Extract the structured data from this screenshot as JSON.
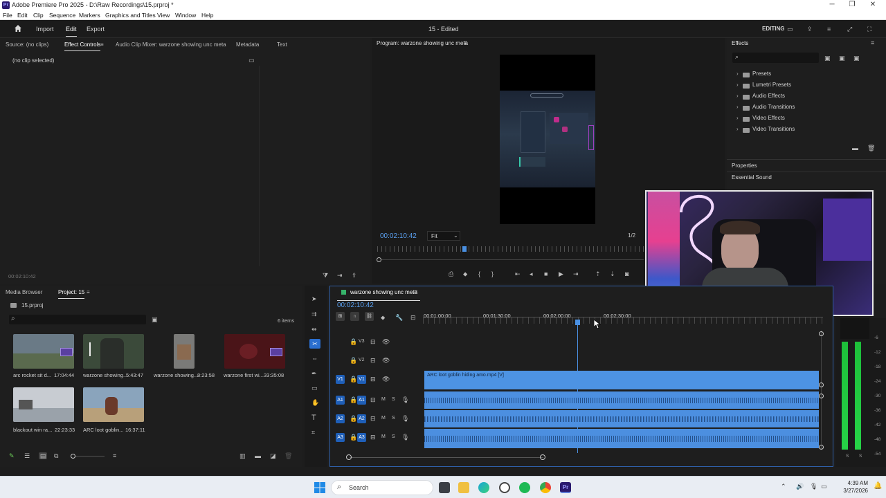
{
  "window": {
    "title": "Adobe Premiere Pro 2025 - D:\\Raw Recordings\\15.prproj *",
    "logo": "Pr"
  },
  "menu": [
    "File",
    "Edit",
    "Clip",
    "Sequence",
    "Markers",
    "Graphics and Titles",
    "View",
    "Window",
    "Help"
  ],
  "header": {
    "nav": [
      "Import",
      "Edit",
      "Export"
    ],
    "active": "Edit",
    "project_title": "15 - Edited",
    "workspace": "EDITING"
  },
  "source_panel": {
    "tabs": [
      "Source: (no clips)",
      "Effect Controls",
      "Audio Clip Mixer: warzone showing unc meta",
      "Metadata",
      "Text"
    ],
    "active_tab": "Effect Controls",
    "empty_msg": "(no clip selected)",
    "timecode": "00:02:10:42"
  },
  "program": {
    "title": "Program: warzone showing unc meta",
    "timecode": "00:02:10:42",
    "fit": "Fit",
    "resolution": "1/2"
  },
  "effects": {
    "title": "Effects",
    "items": [
      "Presets",
      "Lumetri Presets",
      "Audio Effects",
      "Audio Transitions",
      "Video Effects",
      "Video Transitions"
    ],
    "properties": "Properties",
    "essential_sound": "Essential Sound"
  },
  "project": {
    "tabs": [
      "Media Browser",
      "Project: 15"
    ],
    "active_tab": "Project: 15",
    "file": "15.prproj",
    "count": "6 items",
    "clips": [
      {
        "name": "arc rocket sit d...",
        "duration": "17:04:44",
        "bg": "#6a7a86"
      },
      {
        "name": "warzone showing...",
        "duration": "5:43:47",
        "bg": "#3b4a3a"
      },
      {
        "name": "warzone showing...",
        "duration": "8:23:58",
        "bg": "#7a7a78"
      },
      {
        "name": "warzone first wi...",
        "duration": "33:35:08",
        "bg": "#4a1418"
      },
      {
        "name": "blackout win ra...",
        "duration": "22:23:33",
        "bg": "#c8ccd2"
      },
      {
        "name": "ARC loot goblin...",
        "duration": "16:37:11",
        "bg": "#8aa4bc"
      }
    ]
  },
  "timeline": {
    "sequence": "warzone showing unc meta",
    "timecode": "00:02:10:42",
    "ruler": [
      "00:01:00:00",
      "00:01:30:00",
      "00:02:00:00",
      "00:02:30:00"
    ],
    "tracks": [
      {
        "id": "V3",
        "target": ""
      },
      {
        "id": "V2",
        "target": ""
      },
      {
        "id": "V1",
        "target": "V1"
      },
      {
        "id": "A1",
        "target": "A1"
      },
      {
        "id": "A2",
        "target": "A2"
      },
      {
        "id": "A3",
        "target": "A3"
      }
    ],
    "video_clip": "ARC loot goblin hiding amo.mp4 [V]",
    "meter_labels": [
      "-6",
      "-12",
      "-18",
      "-24",
      "-30",
      "-36",
      "-42",
      "-48",
      "-54"
    ],
    "meter_footer": [
      "S",
      "S"
    ]
  },
  "taskbar": {
    "search": "Search",
    "time": "4:39 AM",
    "date": "3/27/2026"
  }
}
